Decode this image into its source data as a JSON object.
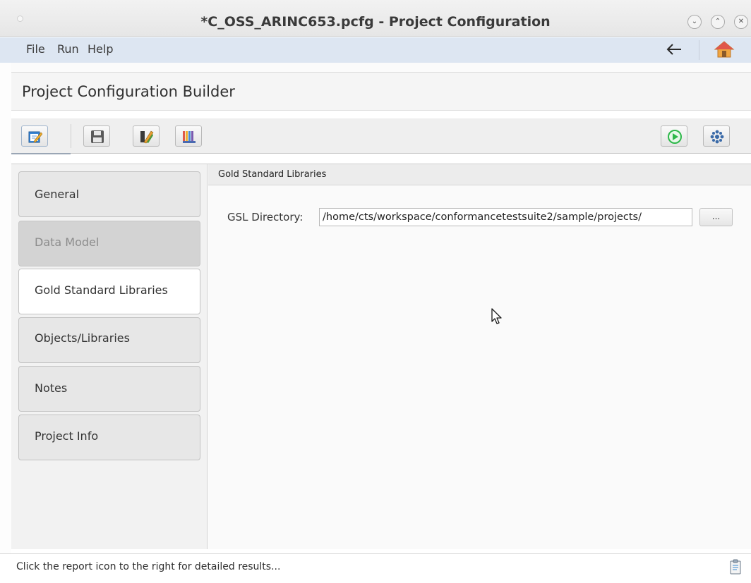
{
  "window": {
    "title": "*C_OSS_ARINC653.pcfg - Project Configuration",
    "controls": {
      "minimize": "⌄",
      "maximize": "⌃",
      "close": "✕"
    }
  },
  "menubar": {
    "items": [
      "File",
      "Run",
      "Help"
    ],
    "icons": [
      "back-arrow-icon",
      "home-icon"
    ]
  },
  "header": {
    "title": "Project Configuration Builder"
  },
  "toolbar": {
    "left_buttons": [
      "edit-icon",
      "save-icon",
      "pen-icon",
      "columns-icon"
    ],
    "right_buttons": [
      "run-icon",
      "settings-icon"
    ]
  },
  "sidebar": {
    "items": [
      {
        "label": "General",
        "state": "normal"
      },
      {
        "label": "Data Model",
        "state": "disabled"
      },
      {
        "label": "Gold Standard Libraries",
        "state": "selected"
      },
      {
        "label": "Objects/Libraries",
        "state": "normal"
      },
      {
        "label": "Notes",
        "state": "normal"
      },
      {
        "label": "Project Info",
        "state": "normal"
      }
    ]
  },
  "content": {
    "section_title": "Gold Standard Libraries",
    "gsl_label": "GSL Directory:",
    "gsl_value": "/home/cts/workspace/conformancetestsuite2/sample/projects/",
    "browse_label": "..."
  },
  "statusbar": {
    "message": "Click the report icon to the right for detailed results..."
  },
  "colors": {
    "menubar_bg": "#dde6f2",
    "run_green": "#2eb84a",
    "selected_tab_bg": "#ffffff",
    "disabled_tab_bg": "#d3d3d3"
  }
}
